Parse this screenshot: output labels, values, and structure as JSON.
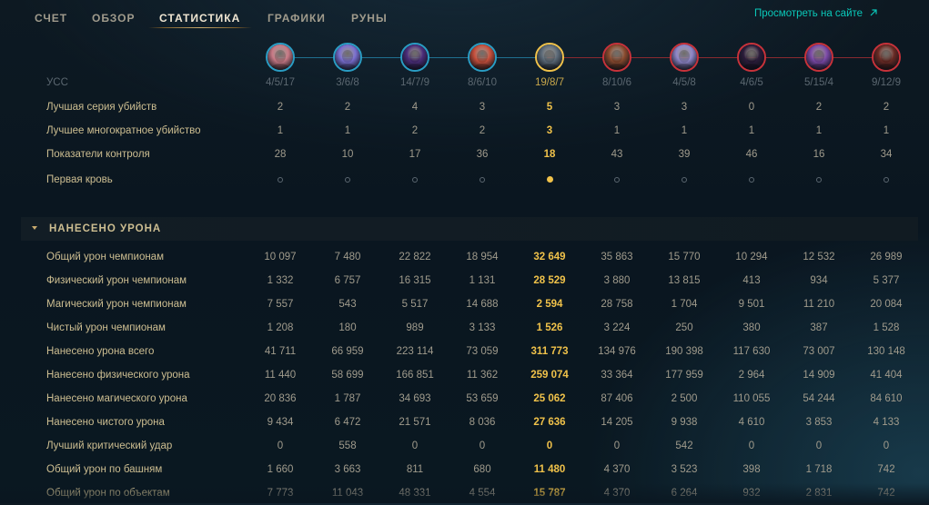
{
  "nav": {
    "tabs": [
      {
        "label": "СЧЕТ",
        "active": false
      },
      {
        "label": "ОБЗОР",
        "active": false
      },
      {
        "label": "СТАТИСТИКА",
        "active": true
      },
      {
        "label": "ГРАФИКИ",
        "active": false
      },
      {
        "label": "РУНЫ",
        "active": false
      }
    ],
    "site_link": "Просмотреть на сайте",
    "site_link_icon": "external-arrow-icon"
  },
  "colors": {
    "ally_ring": "#2a9dc4",
    "self_ring": "#f0c24a",
    "enemy_ring": "#c8323a",
    "highlight_text": "#f0c24a",
    "link": "#0ac8b9"
  },
  "champions": [
    {
      "team": "ally",
      "icon": "champion-portrait-pink-haired",
      "tint": "#c97a86"
    },
    {
      "team": "ally",
      "icon": "champion-portrait-blue-haired",
      "tint": "#7a6fd0"
    },
    {
      "team": "ally",
      "icon": "champion-portrait-purple-hooded",
      "tint": "#4b2d7a"
    },
    {
      "team": "ally",
      "icon": "champion-portrait-red-haired",
      "tint": "#c8503c"
    },
    {
      "team": "self",
      "icon": "champion-portrait-armored",
      "tint": "#5c6a78"
    },
    {
      "team": "enemy",
      "icon": "champion-portrait-brown-beast",
      "tint": "#8a4a2e"
    },
    {
      "team": "enemy",
      "icon": "champion-portrait-white-mage",
      "tint": "#8e86c8"
    },
    {
      "team": "enemy",
      "icon": "champion-portrait-dark-creature",
      "tint": "#2b1c3a"
    },
    {
      "team": "enemy",
      "icon": "champion-portrait-violet-figure",
      "tint": "#7c4aa8"
    },
    {
      "team": "enemy",
      "icon": "champion-portrait-red-demon",
      "tint": "#6a2a24"
    }
  ],
  "self_index": 4,
  "top_rows": [
    {
      "label": "УСС",
      "kind": "kda",
      "values": [
        "4/5/17",
        "3/6/8",
        "14/7/9",
        "8/6/10",
        "19/8/7",
        "8/10/6",
        "4/5/8",
        "4/6/5",
        "5/15/4",
        "9/12/9"
      ]
    },
    {
      "label": "Лучшая серия убийств",
      "values": [
        "2",
        "2",
        "4",
        "3",
        "5",
        "3",
        "3",
        "0",
        "2",
        "2"
      ]
    },
    {
      "label": "Лучшее многократное убийство",
      "values": [
        "1",
        "1",
        "2",
        "2",
        "3",
        "1",
        "1",
        "1",
        "1",
        "1"
      ]
    },
    {
      "label": "Показатели контроля",
      "values": [
        "28",
        "10",
        "17",
        "36",
        "18",
        "43",
        "39",
        "46",
        "16",
        "34"
      ]
    },
    {
      "label": "Первая кровь",
      "kind": "first-blood",
      "values": [
        false,
        false,
        false,
        false,
        true,
        false,
        false,
        false,
        false,
        false
      ]
    }
  ],
  "damage_section": {
    "title": "НАНЕСЕНО УРОНА",
    "expanded": true,
    "rows": [
      {
        "label": "Общий урон чемпионам",
        "values": [
          "10 097",
          "7 480",
          "22 822",
          "18 954",
          "32 649",
          "35 863",
          "15 770",
          "10 294",
          "12 532",
          "26 989"
        ]
      },
      {
        "label": "Физический урон чемпионам",
        "values": [
          "1 332",
          "6 757",
          "16 315",
          "1 131",
          "28 529",
          "3 880",
          "13 815",
          "413",
          "934",
          "5 377"
        ]
      },
      {
        "label": "Магический урон чемпионам",
        "values": [
          "7 557",
          "543",
          "5 517",
          "14 688",
          "2 594",
          "28 758",
          "1 704",
          "9 501",
          "11 210",
          "20 084"
        ]
      },
      {
        "label": "Чистый урон чемпионам",
        "values": [
          "1 208",
          "180",
          "989",
          "3 133",
          "1 526",
          "3 224",
          "250",
          "380",
          "387",
          "1 528"
        ]
      },
      {
        "label": "Нанесено урона всего",
        "values": [
          "41 711",
          "66 959",
          "223 114",
          "73 059",
          "311 773",
          "134 976",
          "190 398",
          "117 630",
          "73 007",
          "130 148"
        ]
      },
      {
        "label": "Нанесено физического урона",
        "values": [
          "11 440",
          "58 699",
          "166 851",
          "11 362",
          "259 074",
          "33 364",
          "177 959",
          "2 964",
          "14 909",
          "41 404"
        ]
      },
      {
        "label": "Нанесено магического урона",
        "values": [
          "20 836",
          "1 787",
          "34 693",
          "53 659",
          "25 062",
          "87 406",
          "2 500",
          "110 055",
          "54 244",
          "84 610"
        ]
      },
      {
        "label": "Нанесено чистого урона",
        "values": [
          "9 434",
          "6 472",
          "21 571",
          "8 036",
          "27 636",
          "14 205",
          "9 938",
          "4 610",
          "3 853",
          "4 133"
        ]
      },
      {
        "label": "Лучший критический удар",
        "values": [
          "0",
          "558",
          "0",
          "0",
          "0",
          "0",
          "542",
          "0",
          "0",
          "0"
        ]
      },
      {
        "label": "Общий урон по башням",
        "values": [
          "1 660",
          "3 663",
          "811",
          "680",
          "11 480",
          "4 370",
          "3 523",
          "398",
          "1 718",
          "742"
        ]
      },
      {
        "label": "Общий урон по объектам",
        "values": [
          "7 773",
          "11 043",
          "48 331",
          "4 554",
          "15 787",
          "4 370",
          "6 264",
          "932",
          "2 831",
          "742"
        ]
      }
    ]
  }
}
